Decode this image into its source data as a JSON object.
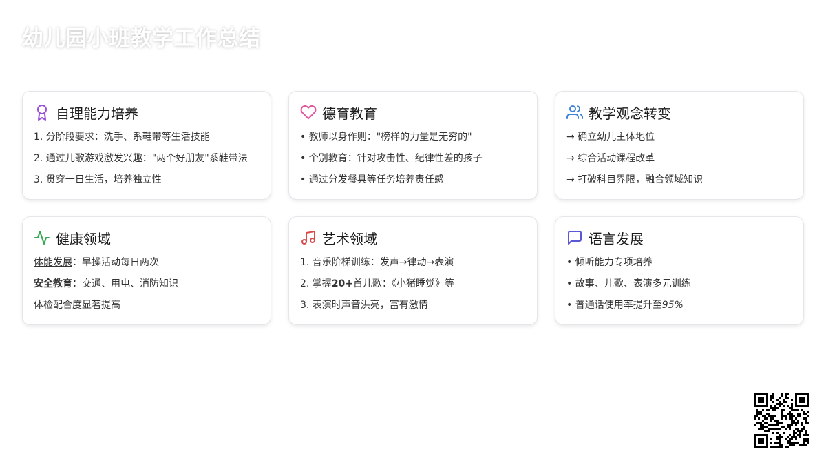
{
  "page": {
    "title": "幼儿园小班教学工作总结"
  },
  "colors": {
    "purple": "#9b4fd6",
    "pink": "#e0569b",
    "blue": "#3f83d8",
    "green": "#2fa84f",
    "red": "#d94a4a",
    "indigo": "#5b57d6",
    "gold": "#c58a10"
  },
  "cards": [
    {
      "title": "自理能力培养",
      "icon": "award-icon",
      "lines": [
        "1. 分阶段要求：洗手、系鞋带等生活技能",
        "2. 通过儿歌游戏激发兴趣：\"两个好朋友\"系鞋带法",
        "3. 贯穿一日生活，培养独立性"
      ]
    },
    {
      "title": "德育教育",
      "icon": "heart-icon",
      "lines": [
        "• 教师以身作则：\"榜样的力量是无穷的\"",
        "• 个别教育：针对攻击性、纪律性差的孩子",
        "• 通过分发餐具等任务培养责任感"
      ]
    },
    {
      "title": "教学观念转变",
      "icon": "users-icon",
      "lines": [
        "→ 确立幼儿主体地位",
        "→ 综合活动课程改革",
        "→ 打破科目界限，融合领域知识"
      ]
    },
    {
      "title": "健康领域",
      "icon": "activity-icon",
      "line1_label": "体能发展",
      "line1_text": "：早操活动每日两次",
      "line2_label": "安全教育",
      "line2_text": "：交通、用电、消防知识",
      "line3": "体检配合度显著提高"
    },
    {
      "title": "艺术领域",
      "icon": "music-icon",
      "line1": "1. 音乐阶梯训练：发声→律动→表演",
      "line2_pre": "2. 掌握",
      "line2_bold": "20+",
      "line2_post": "首儿歌：《小猪睡觉》等",
      "line3": "3. 表演时声音洪亮，富有激情"
    },
    {
      "title": "语言发展",
      "icon": "message-square-icon",
      "line1": "• 倾听能力专项培养",
      "line2": "• 故事、儿歌、表演多元训练",
      "line3_pre": "• 普通话使用率提升至",
      "line3_em": "95%"
    }
  ],
  "qr": {
    "icon": "qr-code-icon"
  }
}
